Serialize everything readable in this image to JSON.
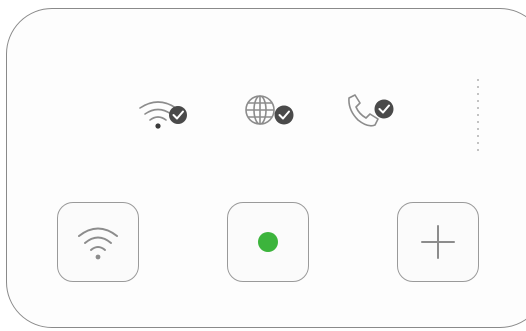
{
  "status_icons": [
    {
      "icon": "wifi-connected-icon",
      "state": "connected"
    },
    {
      "icon": "globe-connected-icon",
      "state": "connected"
    },
    {
      "icon": "phone-connected-icon",
      "state": "connected"
    }
  ],
  "controls": [
    {
      "icon": "wifi-icon"
    },
    {
      "icon": "status-dot-icon",
      "color": "#3cb43c"
    },
    {
      "icon": "plus-icon"
    }
  ],
  "colors": {
    "icon_gray": "#8c8c8c",
    "check_dark": "#4a4a4a",
    "status_green": "#3cb43c"
  }
}
